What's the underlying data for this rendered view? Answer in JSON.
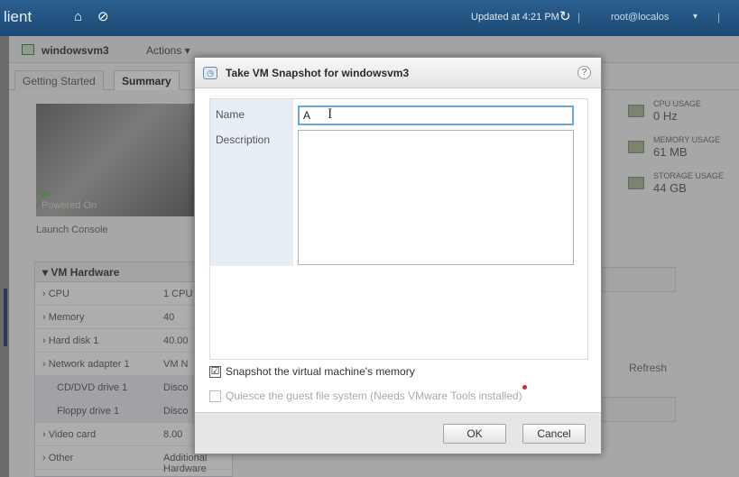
{
  "topbar": {
    "brand": "lient",
    "home_icon": "home-icon",
    "history_icon": "history-icon",
    "updated": "Updated at 4:21 PM",
    "user": "root@localos",
    "separator": "|"
  },
  "vm": {
    "name": "windowsvm3",
    "actions": "Actions ▾"
  },
  "tabs": [
    {
      "label": "Getting Started"
    },
    {
      "label": "Summary"
    }
  ],
  "console": {
    "status": "Powered On",
    "launch": "Launch Console"
  },
  "hardware": {
    "title": "VM Hardware",
    "rows": [
      {
        "key": "› CPU",
        "value": "1 CPU"
      },
      {
        "key": "› Memory",
        "value": "40"
      },
      {
        "key": "› Hard disk 1",
        "value": "40.00"
      },
      {
        "key": "› Network adapter 1",
        "value": "VM N"
      },
      {
        "key": "CD/DVD drive 1",
        "value": "Disco"
      },
      {
        "key": "Floppy drive 1",
        "value": "Disco"
      },
      {
        "key": "› Video card",
        "value": "8.00"
      },
      {
        "key": "› Other",
        "value": "Additional Hardware"
      }
    ]
  },
  "stats": [
    {
      "label": "CPU USAGE",
      "value": "0 Hz"
    },
    {
      "label": "MEMORY USAGE",
      "value": "61 MB"
    },
    {
      "label": "STORAGE USAGE",
      "value": "44 GB"
    }
  ],
  "refresh_link": "Refresh",
  "dialog": {
    "title": "Take VM Snapshot for windowsvm3",
    "help": "?",
    "name_label": "Name",
    "name_value": "A",
    "description_label": "Description",
    "description_value": "",
    "memory_checkbox": "Snapshot the virtual machine's memory",
    "memory_checked": "☑",
    "quiesce_checkbox": "Quiesce the guest file system (Needs VMware Tools installed)",
    "ok": "OK",
    "cancel": "Cancel"
  },
  "colors": {
    "topbar": "#1d4a75",
    "dialog_label_bg": "#e8eef5",
    "input_focus": "#6aa6d8"
  }
}
